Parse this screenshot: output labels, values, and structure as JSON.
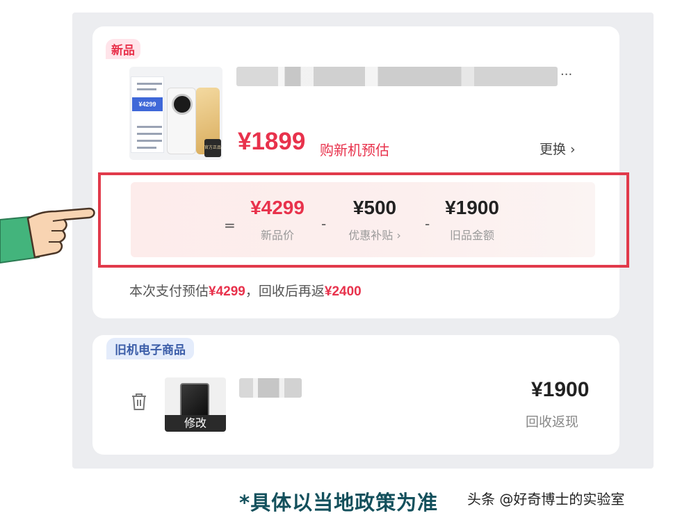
{
  "new_item": {
    "tag": "新品",
    "image_text": "¥4299",
    "image_badge": "官方正品",
    "title_ellipsis": "...",
    "price": "¥1899",
    "price_label": "购新机预估",
    "change_label": "更换",
    "change_chevron": "›"
  },
  "calc": {
    "equals": "=",
    "minus": "-",
    "items": [
      {
        "value": "¥4299",
        "label": "新品价",
        "color": "#e8324c"
      },
      {
        "value": "¥500",
        "label": "优惠补贴 ›",
        "color": "#222222"
      },
      {
        "value": "¥1900",
        "label": "旧品金额",
        "color": "#222222"
      }
    ],
    "highlight_color": "#e13a4b"
  },
  "summary": {
    "pay_prefix": "本次支付预估",
    "pay_amount": "¥4299",
    "separator": "，",
    "return_prefix": "回收后再返",
    "return_amount": "¥2400"
  },
  "old_item": {
    "tag": "旧机电子商品",
    "edit_label": "修改",
    "price": "¥1900",
    "price_label": "回收返现"
  },
  "footnote": "*具体以当地政策为准",
  "watermark": "头条 @好奇博士的实验室",
  "colors": {
    "accent_red": "#e8324c",
    "tag_blue": "#3b5da8",
    "footnote_teal": "#13505c"
  },
  "icons": {
    "trash": "trash-icon",
    "pointing_hand": "pointing-hand-icon"
  }
}
